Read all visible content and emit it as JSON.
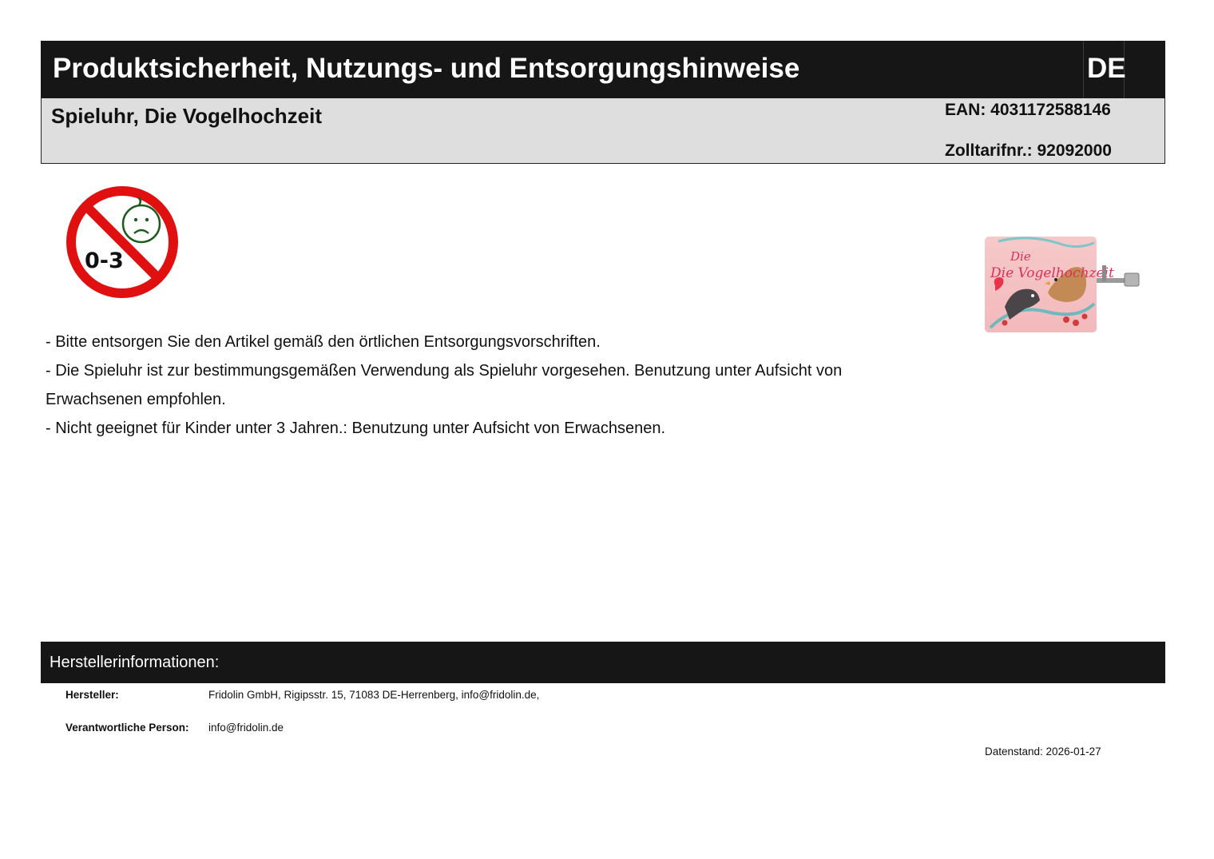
{
  "header": {
    "title": "Produktsicherheit, Nutzungs- und Entsorgungshinweise",
    "language": "DE"
  },
  "product": {
    "name": "Spieluhr, Die Vogelhochzeit",
    "ean": "EAN: 4031172588146",
    "zolltarif": "Zolltarifnr.: 92092000",
    "photo_label": "Die Vogelhochzeit"
  },
  "age_warning": {
    "label": "0-3",
    "icon": "not-for-children-under-3-icon",
    "colors": {
      "ring": "#e01010",
      "face": "#1f5a1f"
    }
  },
  "notes": [
    "- Bitte entsorgen Sie den Artikel gemäß den örtlichen Entsorgungsvorschriften.",
    "- Die Spieluhr ist zur bestimmungsgemäßen Verwendung als Spieluhr vorgesehen. Benutzung unter Aufsicht von Erwachsenen empfohlen.",
    "- Nicht geeignet für Kinder unter 3 Jahren.: Benutzung unter Aufsicht von Erwachsenen."
  ],
  "manufacturer": {
    "section_title": "Herstellerinformationen:",
    "maker_label": "Hersteller:",
    "maker_value": "Fridolin GmbH, Rigipsstr. 15, 71083 DE-Herrenberg, info@fridolin.de,",
    "responsible_label": "Verantwortliche Person:",
    "responsible_value": "info@fridolin.de"
  },
  "datenstand": "Datenstand: 2026-01-27",
  "colors": {
    "header_bg": "#161616",
    "subheader_bg": "#dedede"
  }
}
